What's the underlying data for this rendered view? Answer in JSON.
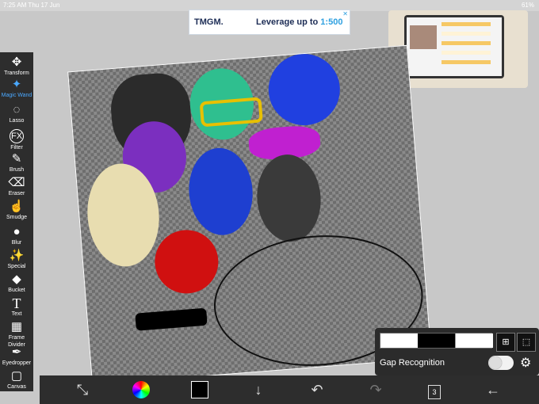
{
  "status": {
    "time_date": "7:25 AM  Thu 17 Jun",
    "battery": "61%"
  },
  "ad": {
    "brand": "TMGM.",
    "text": "Leverage up to ",
    "highlight": "1:500",
    "close": "✕"
  },
  "tools": [
    {
      "label": "Transform",
      "icon": "move-icon",
      "glyph": "✥",
      "active": false
    },
    {
      "label": "Magic Wand",
      "icon": "magic-wand-icon",
      "glyph": "✦",
      "active": true
    },
    {
      "label": "Lasso",
      "icon": "lasso-icon",
      "glyph": "◌",
      "active": false
    },
    {
      "label": "Filter",
      "icon": "filter-fx-icon",
      "glyph": "FX",
      "active": false
    },
    {
      "label": "Brush",
      "icon": "brush-icon",
      "glyph": "✎",
      "active": false
    },
    {
      "label": "Eraser",
      "icon": "eraser-icon",
      "glyph": "⌫",
      "active": false
    },
    {
      "label": "Smudge",
      "icon": "smudge-icon",
      "glyph": "☝",
      "active": false
    },
    {
      "label": "Blur",
      "icon": "blur-drop-icon",
      "glyph": "●",
      "active": false
    },
    {
      "label": "Special",
      "icon": "special-wand-icon",
      "glyph": "✨",
      "active": false
    },
    {
      "label": "Bucket",
      "icon": "bucket-icon",
      "glyph": "◆",
      "active": false
    },
    {
      "label": "Text",
      "icon": "text-icon",
      "glyph": "T",
      "active": false
    },
    {
      "label": "Frame Divider",
      "icon": "frame-divider-icon",
      "glyph": "▦",
      "active": false
    },
    {
      "label": "Eyedropper",
      "icon": "eyedropper-icon",
      "glyph": "✒",
      "active": false
    },
    {
      "label": "Canvas",
      "icon": "canvas-icon",
      "glyph": "▢",
      "active": false
    }
  ],
  "bottom": {
    "layers_count": "3"
  },
  "gap_panel": {
    "label": "Gap Recognition"
  },
  "colors": {
    "toolbar": "#2d2d2d",
    "accent": "#4aa8ff",
    "canvas_bg": "#c8c8c8"
  }
}
